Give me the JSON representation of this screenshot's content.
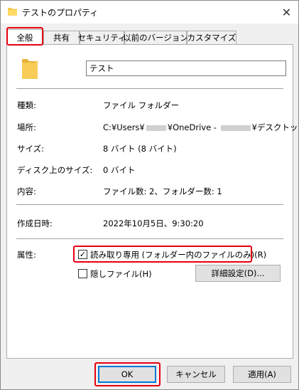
{
  "window": {
    "title": "テストのプロパティ",
    "close_glyph": "✕"
  },
  "tabs": [
    {
      "label": "全般"
    },
    {
      "label": "共有"
    },
    {
      "label": "セキュリティ"
    },
    {
      "label": "以前のバージョン"
    },
    {
      "label": "カスタマイズ"
    }
  ],
  "general": {
    "name_value": "テスト",
    "type_label": "種類:",
    "type_value": "ファイル フォルダー",
    "location_label": "場所:",
    "location_prefix": "C:¥Users¥",
    "location_middle": "¥OneDrive - ",
    "location_suffix": "¥デスクトップ",
    "size_label": "サイズ:",
    "size_value": "8 バイト (8 バイト)",
    "disk_size_label": "ディスク上のサイズ:",
    "disk_size_value": "0 バイト",
    "contents_label": "内容:",
    "contents_value": "ファイル数: 2、フォルダー数: 1",
    "created_label": "作成日時:",
    "created_value": "2022年10月5日、9:30:20",
    "attributes_label": "属性:",
    "readonly_label": "読み取り専用 (フォルダー内のファイルのみ)(R)",
    "readonly_checked": true,
    "hidden_label": "隠しファイル(H)",
    "hidden_checked": false,
    "advanced_button": "詳細設定(D)..."
  },
  "footer": {
    "ok": "OK",
    "cancel": "キャンセル",
    "apply": "適用(A)"
  },
  "colors": {
    "highlight": "#e60012",
    "folder": "#f5c84c",
    "default_button_border": "#0078d7"
  }
}
